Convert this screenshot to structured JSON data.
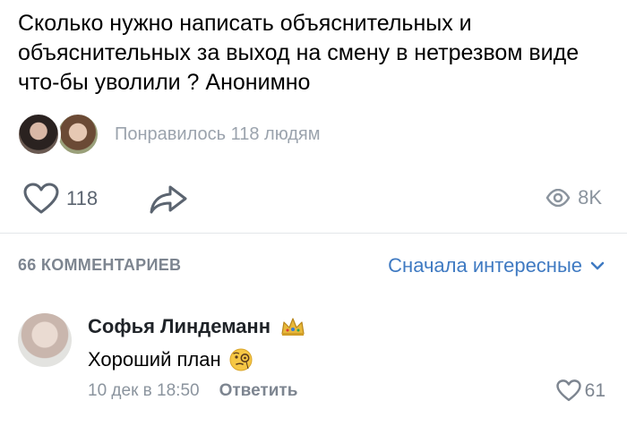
{
  "post": {
    "text": "Сколько нужно написать объяснительных и объяснительных за выход на смену в нетрезвом виде что-бы уволили ? Анонимно"
  },
  "likers": {
    "label": "Понравилось 118 людям"
  },
  "actions": {
    "like_count": "118",
    "views_count": "8K"
  },
  "comments": {
    "count_label": "66 КОММЕНТАРИЕВ",
    "sort_label": "Сначала интересные",
    "items": [
      {
        "author": "Софья Линдеманн",
        "text": "Хороший план",
        "date": "10 дек в 18:50",
        "reply_label": "Ответить",
        "like_count": "61"
      }
    ]
  },
  "colors": {
    "accent": "#3f7ac2",
    "secondary_text": "#8b949e",
    "divider": "#e3e6ea"
  },
  "icons": [
    "heart-icon",
    "share-arrow-icon",
    "eye-icon",
    "chevron-down-icon",
    "crown-icon",
    "monocle-face-emoji"
  ]
}
